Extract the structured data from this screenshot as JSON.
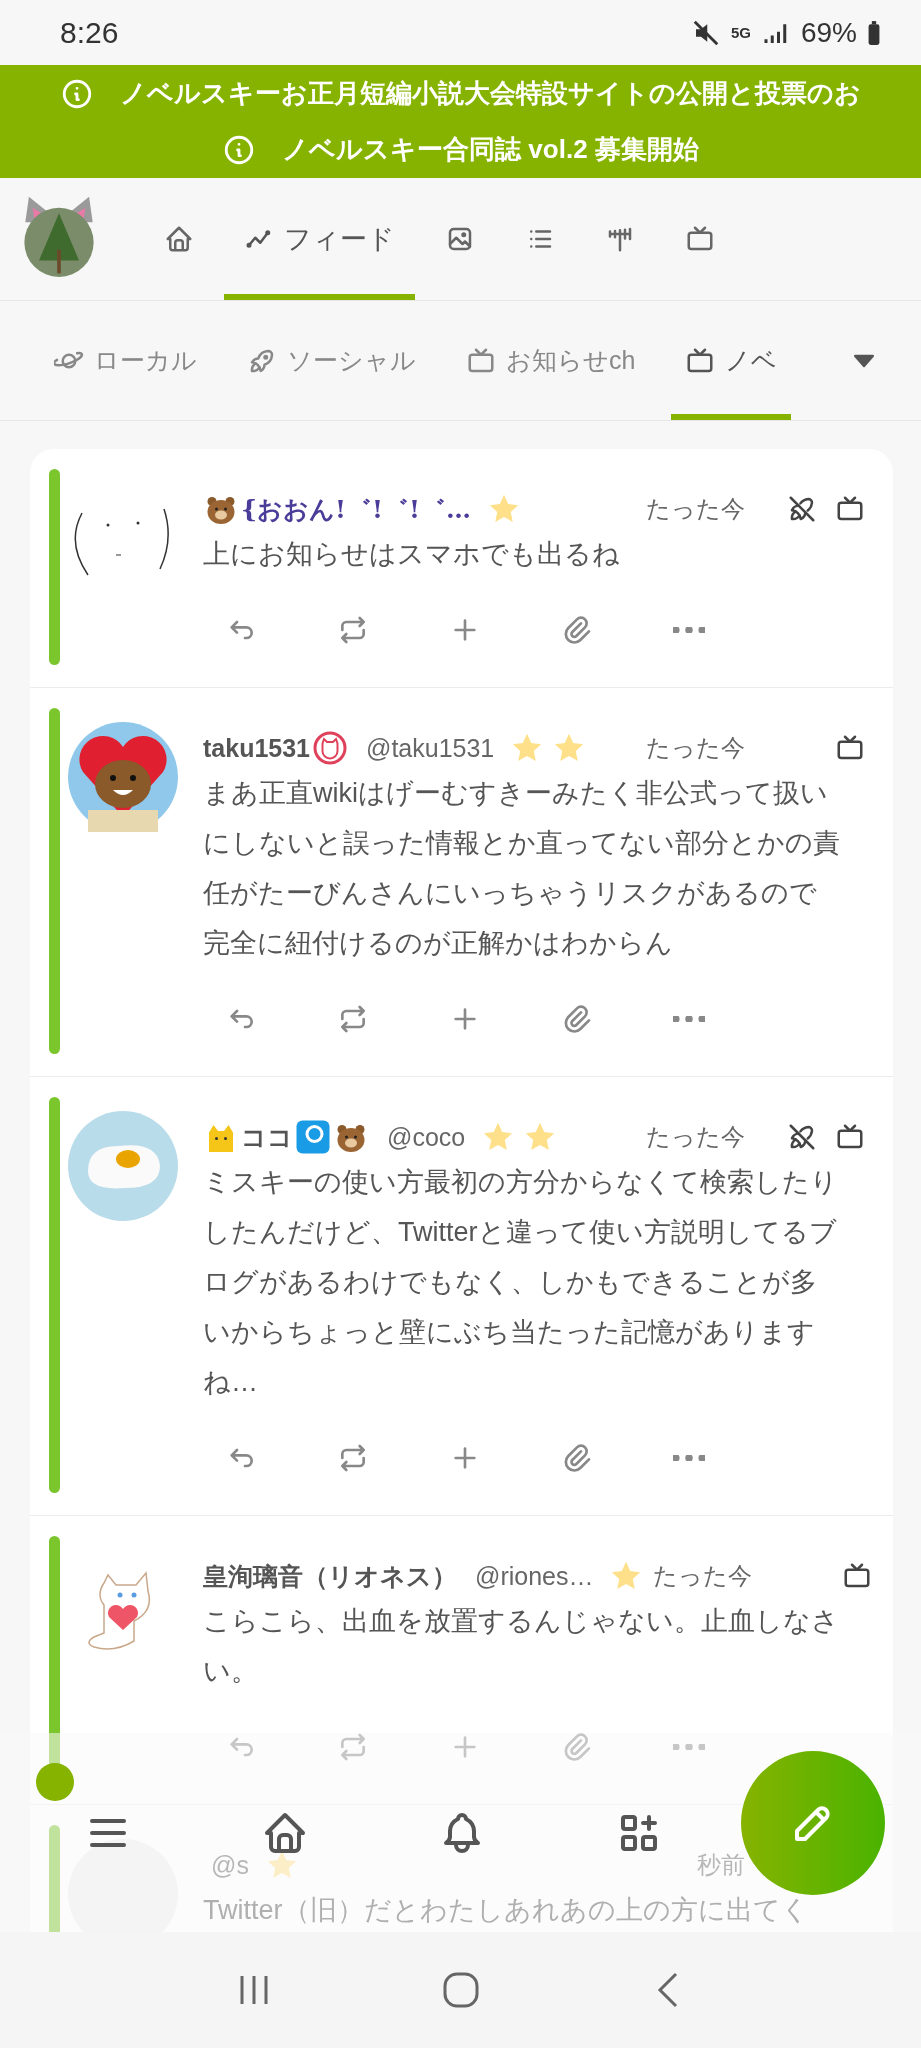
{
  "status_bar": {
    "time": "8:26",
    "network": "5G",
    "battery": "69%"
  },
  "announcements": [
    {
      "text": "ノベルスキーお正月短編小説大会特設サイトの公開と投票のお"
    },
    {
      "text": "ノベルスキー合同誌 vol.2 募集開始"
    }
  ],
  "header_tabs": [
    {
      "kind": "home",
      "selected": false
    },
    {
      "kind": "feed",
      "label": "フィード",
      "selected": true
    },
    {
      "kind": "gallery",
      "selected": false
    },
    {
      "kind": "list",
      "selected": false
    },
    {
      "kind": "antenna",
      "selected": false
    },
    {
      "kind": "channel",
      "selected": false
    }
  ],
  "timeline_tabs": [
    {
      "kind": "local",
      "label": "ローカル",
      "selected": false
    },
    {
      "kind": "social",
      "label": "ソーシャル",
      "selected": false
    },
    {
      "kind": "channel",
      "label": "お知らせch",
      "selected": false
    },
    {
      "kind": "channel",
      "label": "ノベ",
      "selected": true
    }
  ],
  "notes": [
    {
      "avatar": {
        "kind": "sketch"
      },
      "name_parts": [
        {
          "kind": "bear"
        },
        {
          "kind": "fancy",
          "text": "{おおん!゛!゛!゛…"
        }
      ],
      "badges": [
        {
          "kind": "star"
        }
      ],
      "time": "たった今",
      "local_only": true,
      "in_channel": true,
      "text": "上にお知らせはスマホでも出るね"
    },
    {
      "avatar": {
        "kind": "bear"
      },
      "name_parts": [
        {
          "kind": "text",
          "text": "taku1531"
        },
        {
          "kind": "cat-stamp"
        }
      ],
      "handle": "@taku1531",
      "badges": [
        {
          "kind": "star"
        },
        {
          "kind": "star"
        }
      ],
      "time": "たった今",
      "local_only": false,
      "in_channel": true,
      "text": "まあ正直wikiはげーむすきーみたく非公式って扱いにしないと誤った情報とか直ってない部分とかの責任がたーびんさんにいっちゃうリスクがあるので完全に紐付けるのが正解かはわからん"
    },
    {
      "avatar": {
        "kind": "egg"
      },
      "name_parts": [
        {
          "kind": "crown-cat"
        },
        {
          "kind": "text",
          "text": "ココ"
        },
        {
          "kind": "p"
        },
        {
          "kind": "bear"
        }
      ],
      "handle": "@coco",
      "badges": [
        {
          "kind": "star"
        },
        {
          "kind": "star"
        }
      ],
      "time": "たった今",
      "local_only": true,
      "in_channel": true,
      "text": "ミスキーの使い方最初の方分からなくて検索したりしたんだけど、Twitterと違って使い方説明してるブログがあるわけでもなく、しかもできることが多いからちょっと壁にぶち当たった記憶がありますね…"
    },
    {
      "avatar": {
        "kind": "cat"
      },
      "name_parts": [
        {
          "kind": "text",
          "text": "皇洵璃音（リオネス）"
        }
      ],
      "handle": "@riones…",
      "badges": [
        {
          "kind": "star"
        }
      ],
      "time": "たった今",
      "local_only": false,
      "in_channel": true,
      "text": "こらこら、出血を放置するんじゃない。止血しなさい。"
    },
    {
      "avatar": {
        "kind": "blur"
      },
      "handle": "@s",
      "badges": [
        {
          "kind": "star"
        }
      ],
      "time": "秒前",
      "local_only": false,
      "in_channel": false,
      "text": "Twitter（旧）だとわたしあれあの上の方に出てく"
    }
  ]
}
